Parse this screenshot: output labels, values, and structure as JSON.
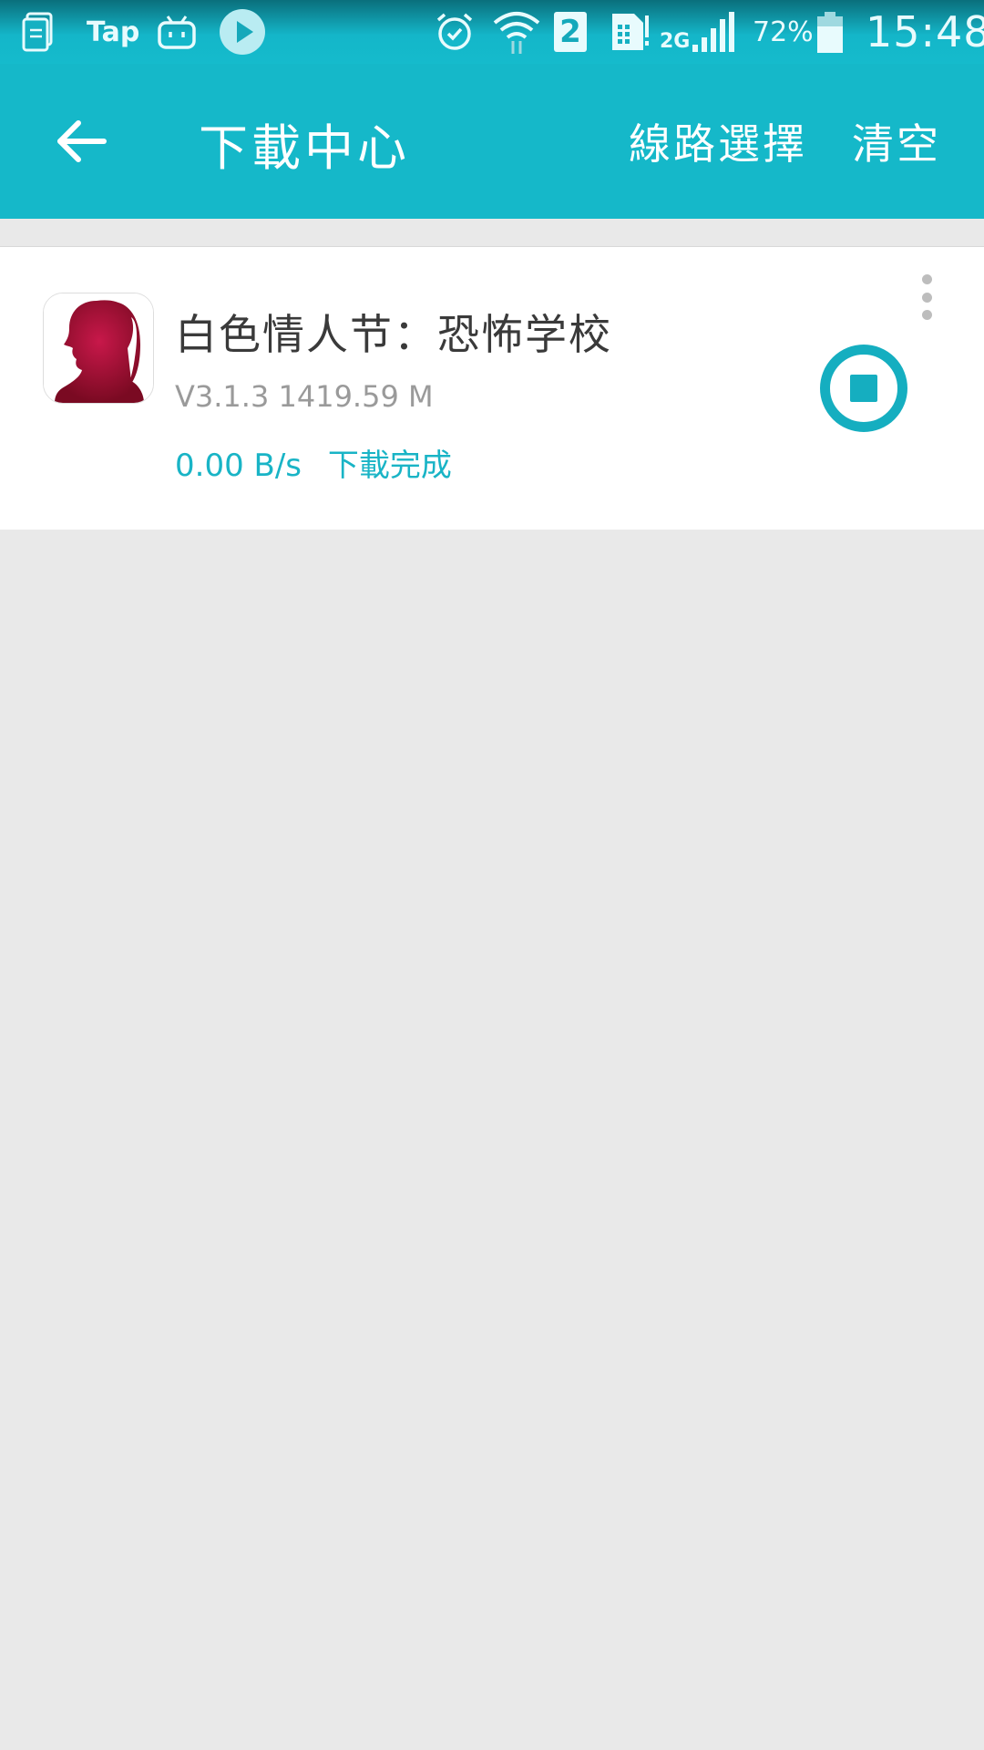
{
  "status_bar": {
    "tap_label": "Tap",
    "sim_slot": "2",
    "network_type": "2G",
    "battery_percent": "72%",
    "time": "15:48",
    "icons": [
      "document-icon",
      "bilibili-tv-icon",
      "play-icon",
      "alarm-icon",
      "wifi-icon",
      "sim-card-icon",
      "signal-icon",
      "battery-icon"
    ]
  },
  "app_bar": {
    "back_icon": "arrow-left-icon",
    "title": "下載中心",
    "route_select_label": "線路選擇",
    "clear_label": "清空"
  },
  "downloads": [
    {
      "name": "白色情人节：恐怖学校",
      "version_size": "V3.1.3  1419.59 M",
      "speed": "0.00 B/s",
      "status": "下載完成",
      "icon": "girl-silhouette-app-icon",
      "action_icon": "stop-circle-icon",
      "menu_icon": "more-vertical-icon"
    }
  ],
  "colors": {
    "accent": "#15b8c9",
    "status_text": "#19b4c6",
    "background": "#e9e9e9",
    "icon_red": "#b0103c"
  }
}
